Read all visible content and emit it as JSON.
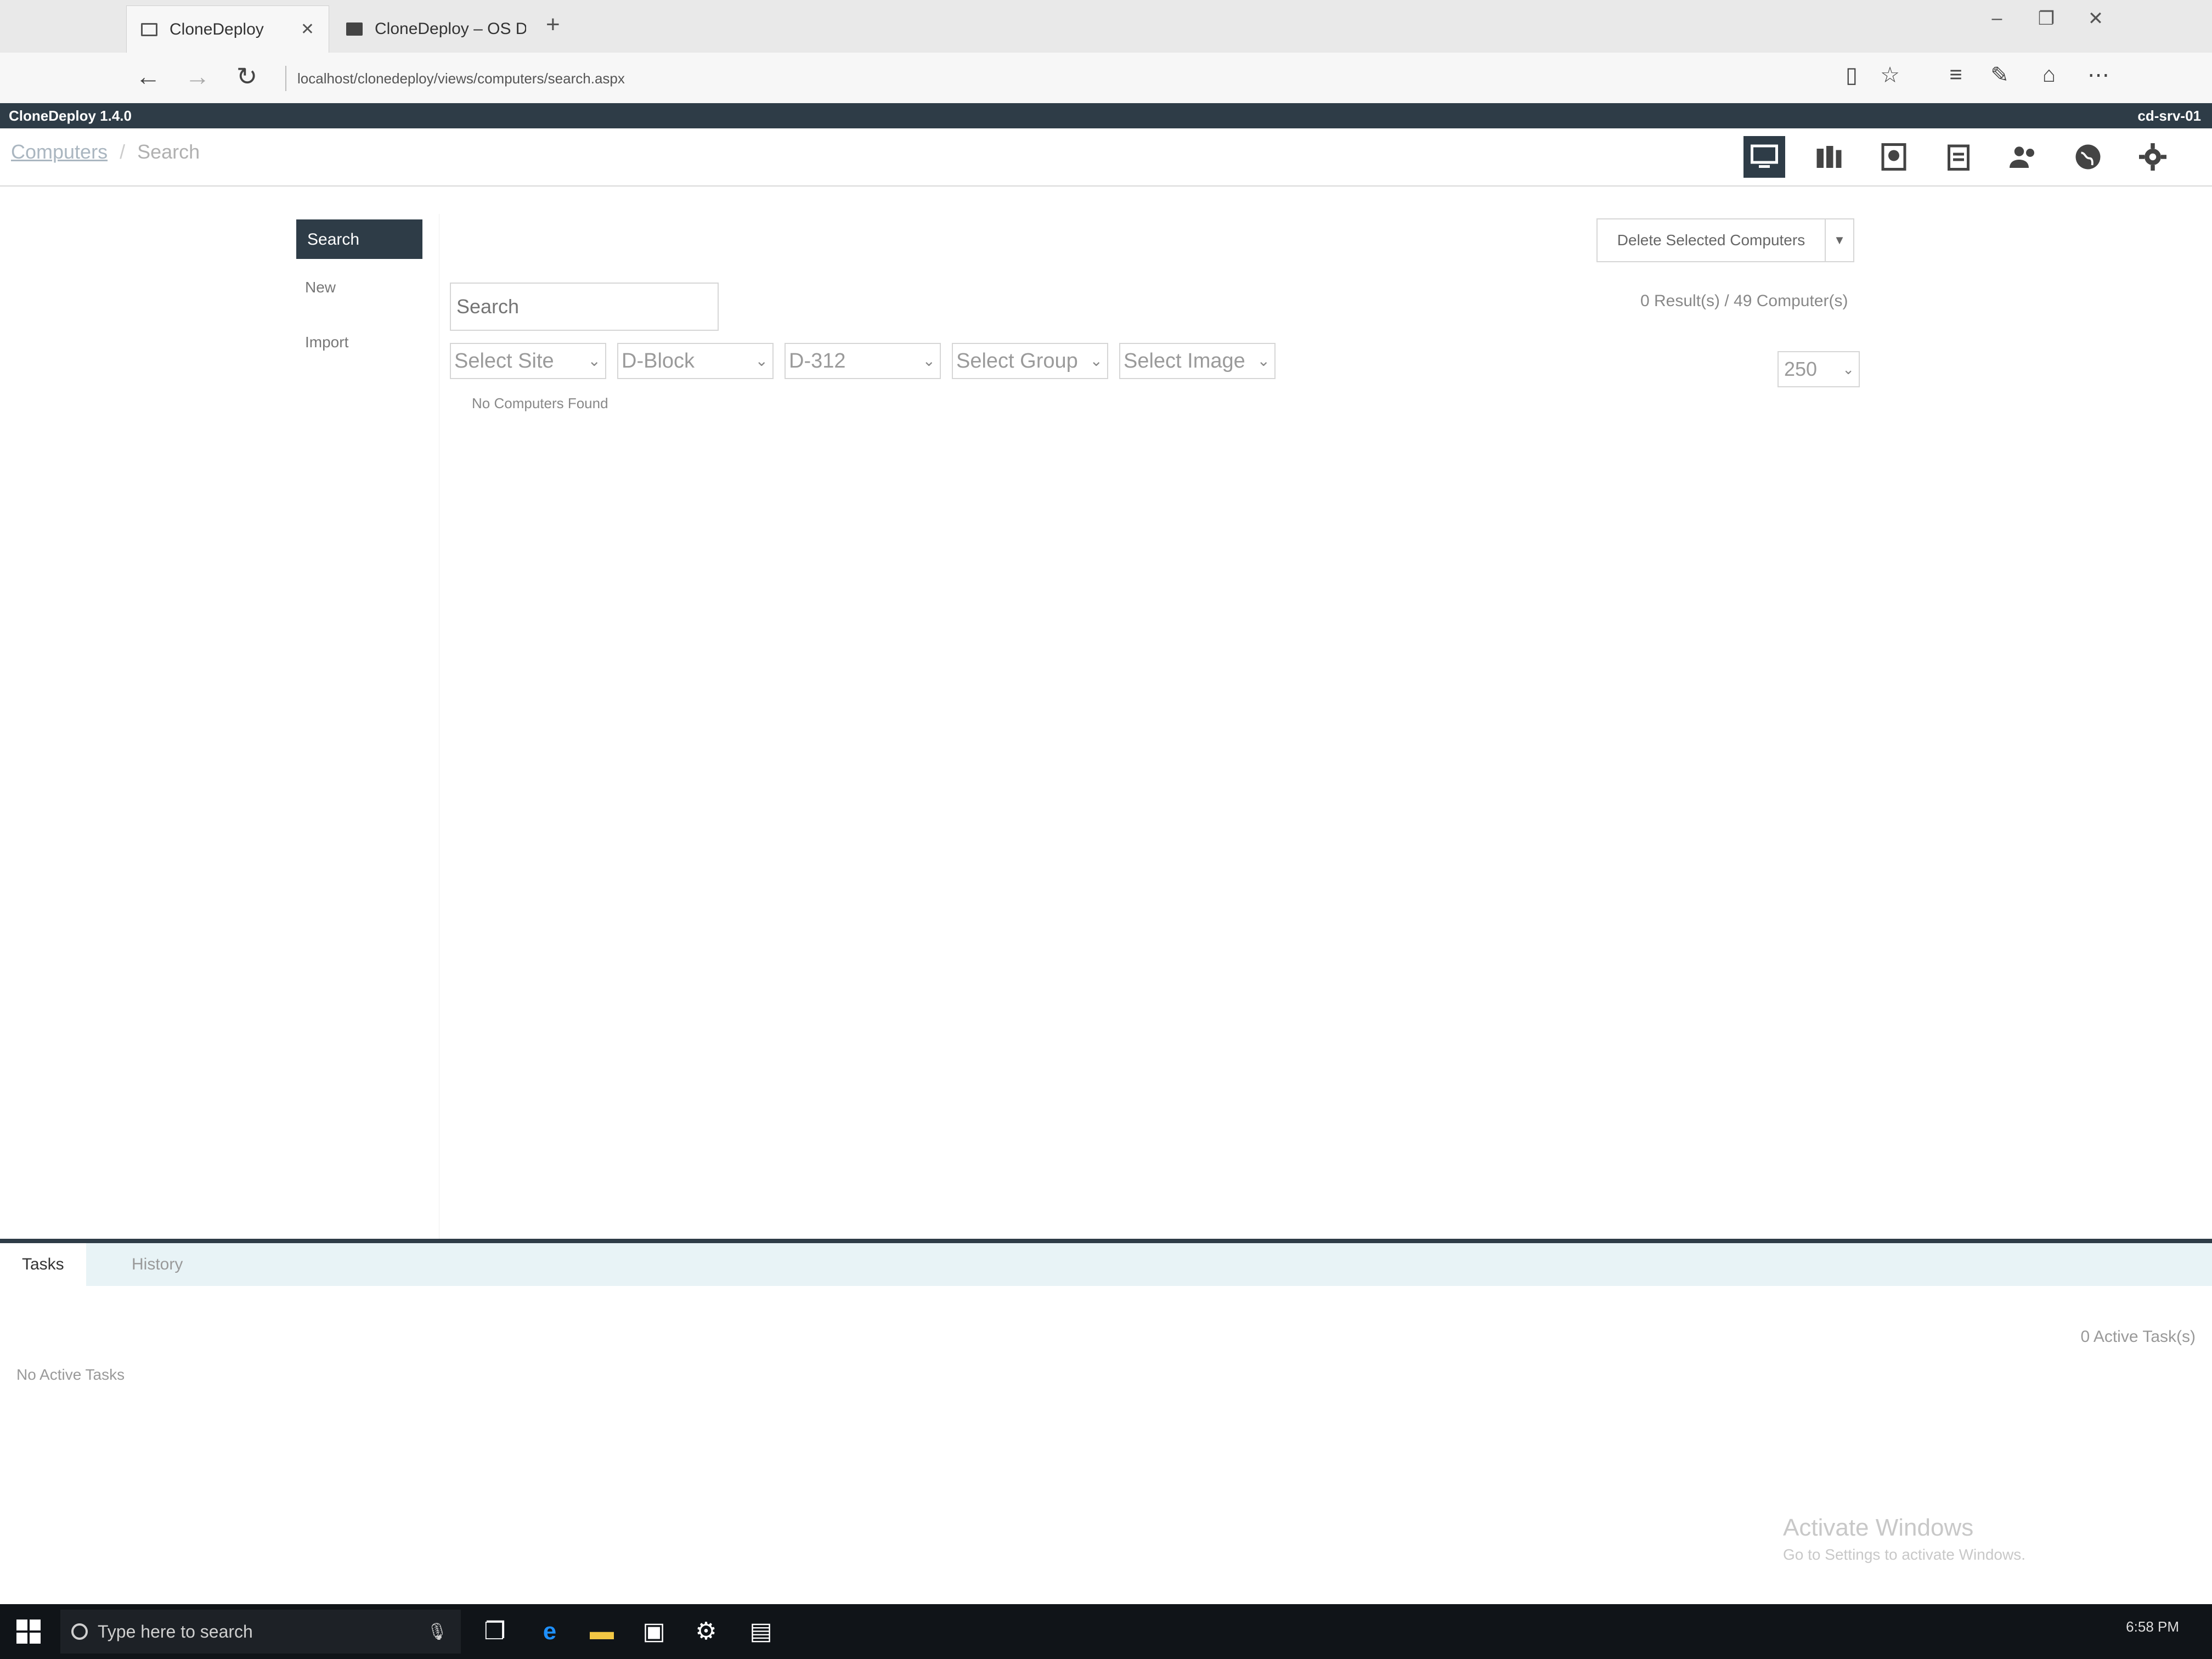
{
  "browser": {
    "tabs": [
      {
        "title": "CloneDeploy",
        "active": true
      },
      {
        "title": "CloneDeploy – OS Deploym",
        "active": false
      }
    ],
    "new_tab": "+",
    "window_controls": [
      "–",
      "❐",
      "✕"
    ],
    "address": "localhost/clonedeploy/views/computers/search.aspx"
  },
  "app": {
    "version": "CloneDeploy 1.4.0",
    "server": "cd-srv-01",
    "accent_color": "#2e3c47"
  },
  "breadcrumb": {
    "link": "Computers",
    "separator": "/",
    "current": "Search"
  },
  "top_icons": [
    "computers-icon",
    "groups-icon",
    "images-icon",
    "tasks-icon",
    "users-icon",
    "global-icon",
    "settings-icon"
  ],
  "sidenav": {
    "search": "Search",
    "new": "New",
    "import": "Import"
  },
  "search": {
    "placeholder": "Search"
  },
  "filters": {
    "site": "Select Site",
    "building": "D-Block",
    "room": "D-312",
    "group": "Select Group",
    "image": "Select Image"
  },
  "results": {
    "empty": "No Computers Found",
    "count": "0 Result(s) / 49 Computer(s)",
    "page_size": "250"
  },
  "actions": {
    "delete": "Delete Selected Computers"
  },
  "tasks": {
    "tabs": [
      "Tasks",
      "History"
    ],
    "active_count": "0 Active Task(s)",
    "empty": "No Active Tasks"
  },
  "watermark": {
    "title": "Activate Windows",
    "subtitle": "Go to Settings to activate Windows."
  },
  "taskbar": {
    "search_placeholder": "Type here to search",
    "time": "6:58 PM"
  }
}
